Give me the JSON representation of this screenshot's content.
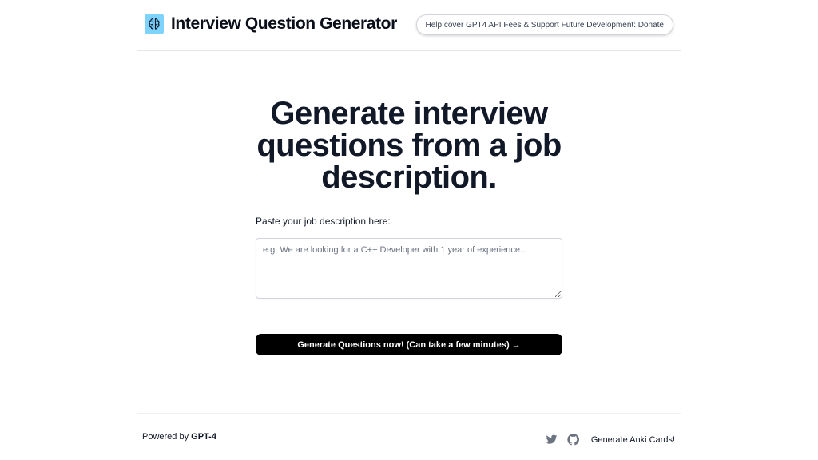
{
  "header": {
    "title": "Interview Question Generator",
    "logo_icon": "brain-icon",
    "donate_label": "Help cover GPT4 API Fees & Support Future Development: Donate"
  },
  "hero": {
    "heading": "Generate interview questions from a job description."
  },
  "form": {
    "label": "Paste your job description here:",
    "placeholder": "e.g. We are looking for a C++ Developer with 1 year of experience...",
    "value": "",
    "submit_label": "Generate Questions now! (Can take a few minutes) →"
  },
  "footer": {
    "powered_prefix": "Powered by ",
    "powered_model": "GPT-4",
    "icons": [
      "twitter-icon",
      "github-icon"
    ],
    "anki_link": "Generate Anki Cards!"
  },
  "colors": {
    "accent": "#000000",
    "logo_bg": "#7dd3fc",
    "text": "#111827",
    "border": "#d1d5db"
  }
}
